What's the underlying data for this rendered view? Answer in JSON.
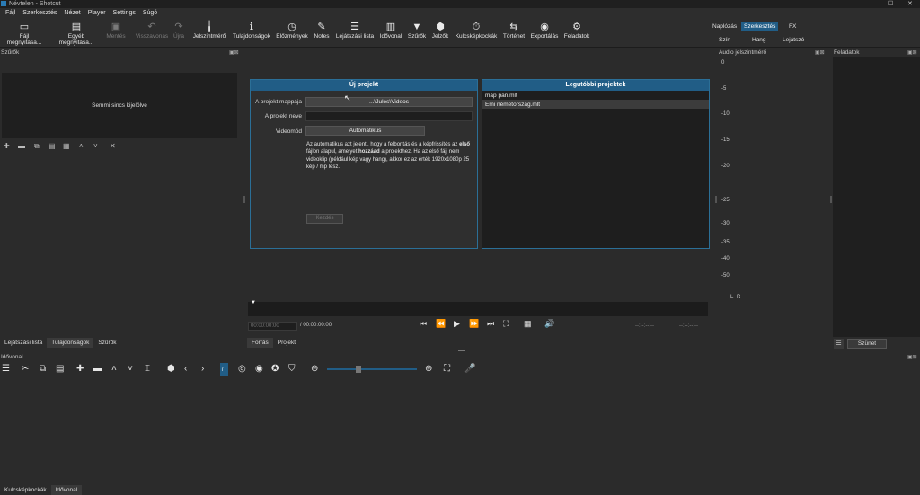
{
  "window": {
    "title": "Névtelen - Shotcut",
    "controls": [
      "—",
      "☐",
      "✕"
    ]
  },
  "menu": [
    "Fájl",
    "Szerkesztés",
    "Nézet",
    "Player",
    "Settings",
    "Súgó"
  ],
  "toolbar": [
    {
      "label": "Fájl megnyitása...",
      "icon": "folder-icon",
      "enabled": true
    },
    {
      "label": "Egyéb megnyitása...",
      "icon": "open-other-icon",
      "enabled": true
    },
    {
      "label": "Mentés",
      "icon": "save-icon",
      "enabled": false
    },
    {
      "label": "Visszavonás",
      "icon": "undo-icon",
      "enabled": false
    },
    {
      "label": "Újra",
      "icon": "redo-icon",
      "enabled": false
    },
    {
      "label": "Jelszintmérő",
      "icon": "meter-icon",
      "enabled": true
    },
    {
      "label": "Tulajdonságok",
      "icon": "info-icon",
      "enabled": true
    },
    {
      "label": "Előzmények",
      "icon": "history-icon",
      "enabled": true
    },
    {
      "label": "Notes",
      "icon": "notes-icon",
      "enabled": true
    },
    {
      "label": "Lejátszási lista",
      "icon": "playlist-icon",
      "enabled": true
    },
    {
      "label": "Idővonal",
      "icon": "timeline-icon",
      "enabled": true
    },
    {
      "label": "Szűrők",
      "icon": "filter-icon",
      "enabled": true
    },
    {
      "label": "Jelzők",
      "icon": "marker-icon",
      "enabled": true
    },
    {
      "label": "Kulcsképkockák",
      "icon": "keyframes-icon",
      "enabled": true
    },
    {
      "label": "Történet",
      "icon": "history2-icon",
      "enabled": true
    },
    {
      "label": "Exportálás",
      "icon": "export-icon",
      "enabled": true
    },
    {
      "label": "Feladatok",
      "icon": "jobs-icon",
      "enabled": true
    }
  ],
  "layouts": {
    "row1": [
      "Naplózás",
      "Szerkesztés",
      "FX"
    ],
    "row2": [
      "Szín",
      "Hang",
      "Lejátszó"
    ],
    "active": "Szerkesztés"
  },
  "filters": {
    "title": "Szűrők",
    "empty_text": "Semmi sincs kijelölve"
  },
  "left_tabs": [
    "Lejátszási lista",
    "Tulajdonságok",
    "Szűrők"
  ],
  "new_project": {
    "title": "Új projekt",
    "folder_label": "A projekt mappája",
    "folder_value": "...\\Jules\\Videos",
    "name_label": "A projekt neve",
    "name_value": "",
    "videomode_label": "Videomód",
    "videomode_value": "Automatikus",
    "info_parts": [
      "Az automatikus azt jelenti, hogy a felbontás és a képfrissítés az ",
      "első",
      " fájlon alapul, amelyet ",
      "hozzáad",
      " a projekthez. Ha az első fájl nem videoklip (például kép vagy hang), akkor ez az érték 1920x1080p 25 kép / mp lesz."
    ],
    "start_label": "Kezdés"
  },
  "recent": {
    "title": "Legutóbbi projektek",
    "items": [
      "map pan.mlt",
      "Emi németország.mlt"
    ]
  },
  "player": {
    "current": "00:00:00:00",
    "total": "/ 00:00:00:00",
    "in_point": "--:--:--:--",
    "out_point": "--:--:--:--",
    "tabs": [
      "Forrás",
      "Projekt"
    ]
  },
  "audio_meter": {
    "title": "Audio jelszintmérő",
    "ticks": [
      "0",
      "-5",
      "-10",
      "-15",
      "-20",
      "-25",
      "-30",
      "-35",
      "-40",
      "-50"
    ],
    "channels": [
      "L",
      "R"
    ]
  },
  "jobs": {
    "title": "Feladatok",
    "pause_label": "Szünet"
  },
  "timeline": {
    "title": "Idővonal"
  },
  "bottom_tabs": [
    "Kulcsképkockák",
    "Idővonal"
  ]
}
